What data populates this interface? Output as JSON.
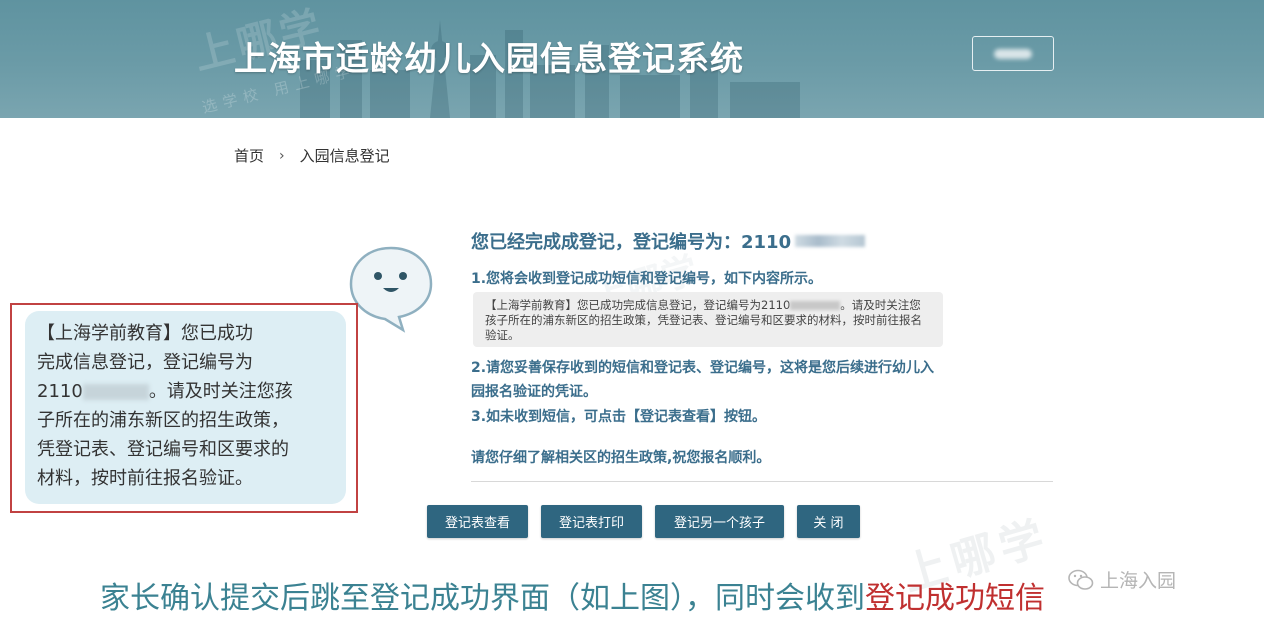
{
  "header": {
    "title": "上海市适龄幼儿入园信息登记系统",
    "watermark": "上哪学",
    "watermark_sub": "选学校 用上哪学"
  },
  "breadcrumb": {
    "home": "首页",
    "separator": "›",
    "current": "入园信息登记"
  },
  "result": {
    "title": "您已经完成成登记，登记编号为：2110",
    "item1": "1.您将会收到登记成功短信和登记编号，如下内容所示。",
    "sms_prefix": "【上海学前教育】您已成功完成信息登记，登记编号为2110",
    "sms_suffix": "。请及时关注您孩子所在的浦东新区的招生政策，凭登记表、登记编号和区要求的材料，按时前往报名验证。",
    "item2": "2.请您妥善保存收到的短信和登记表、登记编号，这将是您后续进行幼儿入园报名验证的凭证。",
    "item3": "3.如未收到短信，可点击【登记表查看】按钮。",
    "wish": "请您仔细了解相关区的招生政策,祝您报名顺利。"
  },
  "buttons": {
    "view": "登记表查看",
    "print": "登记表打印",
    "another": "登记另一个孩子",
    "close": "关 闭"
  },
  "callout": {
    "line1": "【上海学前教育】您已成功",
    "line2": "完成信息登记，登记编号为",
    "line3_prefix": "2110",
    "line3_suffix": "。请及时关注您孩",
    "line4": "子所在的浦东新区的招生政策，",
    "line5": "凭登记表、登记编号和区要求的",
    "line6": "材料，按时前往报名验证。"
  },
  "caption": {
    "text": "家长确认提交后跳至登记成功界面（如上图），同时会收到",
    "highlight": "登记成功短信"
  },
  "wechat": {
    "label": "上海入园"
  },
  "colors": {
    "header_bg": "#6b9ba7",
    "primary": "#2f6680",
    "text_accent": "#3b6e8c",
    "callout_border": "#c14242",
    "callout_bg": "#ddeef4",
    "caption": "#3b8292",
    "highlight": "#c03030"
  }
}
